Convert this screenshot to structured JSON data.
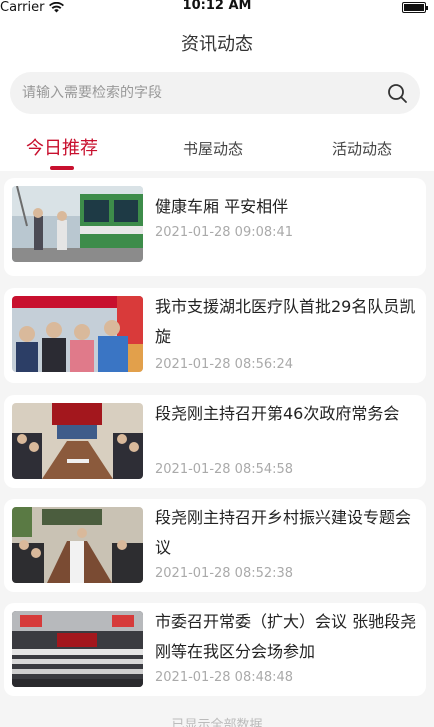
{
  "status": {
    "carrier": "Carrier",
    "time": "10:12 AM"
  },
  "header": {
    "title": "资讯动态"
  },
  "search": {
    "placeholder": "请输入需要检索的字段"
  },
  "tabs": [
    {
      "label": "今日推荐",
      "active": true
    },
    {
      "label": "书屋动态",
      "active": false
    },
    {
      "label": "活动动态",
      "active": false
    }
  ],
  "news": [
    {
      "title": "健康车厢 平安相伴",
      "time": "2021-01-28 09:08:41"
    },
    {
      "title": "我市支援湖北医疗队首批29名队员凯旋",
      "time": "2021-01-28 08:56:24"
    },
    {
      "title": "段尧刚主持召开第46次政府常务会",
      "time": "2021-01-28 08:54:58"
    },
    {
      "title": "段尧刚主持召开乡村振兴建设专题会议",
      "time": "2021-01-28 08:52:38"
    },
    {
      "title": "市委召开常委（扩大）会议 张驰段尧刚等在我区分会场参加",
      "time": "2021-01-28 08:48:48"
    }
  ],
  "footer": {
    "hint": "已显示全部数据"
  },
  "colors": {
    "accent": "#c8102e"
  }
}
